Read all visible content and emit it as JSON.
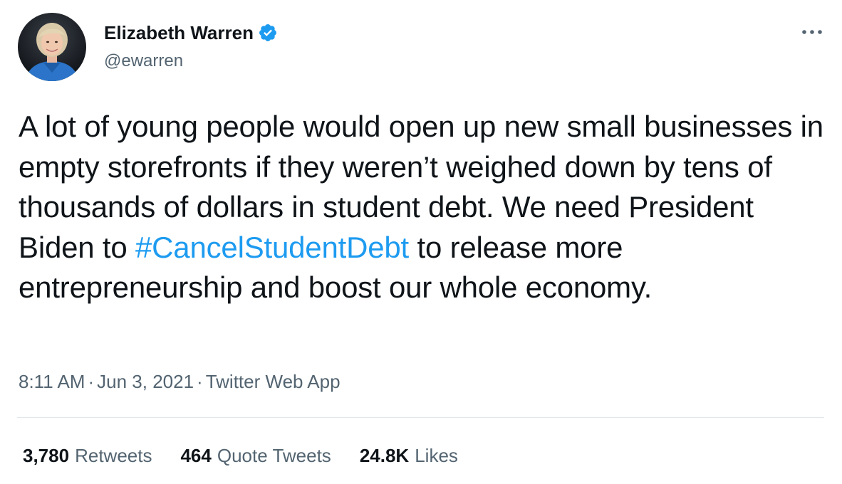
{
  "author": {
    "name": "Elizabeth Warren",
    "handle": "@ewarren",
    "verified": true
  },
  "tweet": {
    "text_before": "A lot of young people would open up new small businesses in empty storefronts if they weren’t weighed down by tens of thousands of dollars in student debt. We need President Biden to ",
    "hashtag": "#CancelStudentDebt",
    "text_after": " to release more entrepreneurship and boost our whole economy."
  },
  "meta": {
    "time": "8:11 AM",
    "separator": "·",
    "date": "Jun 3, 2021",
    "source": "Twitter Web App"
  },
  "stats": {
    "retweets": {
      "count": "3,780",
      "label": "Retweets"
    },
    "quote_tweets": {
      "count": "464",
      "label": "Quote Tweets"
    },
    "likes": {
      "count": "24.8K",
      "label": "Likes"
    }
  },
  "colors": {
    "link": "#1d9bf0",
    "secondary_text": "#536471",
    "primary_text": "#0f1419",
    "verified_badge": "#1d9bf0"
  },
  "icons": {
    "verified": "verified-badge-icon",
    "more": "more-options-icon"
  }
}
